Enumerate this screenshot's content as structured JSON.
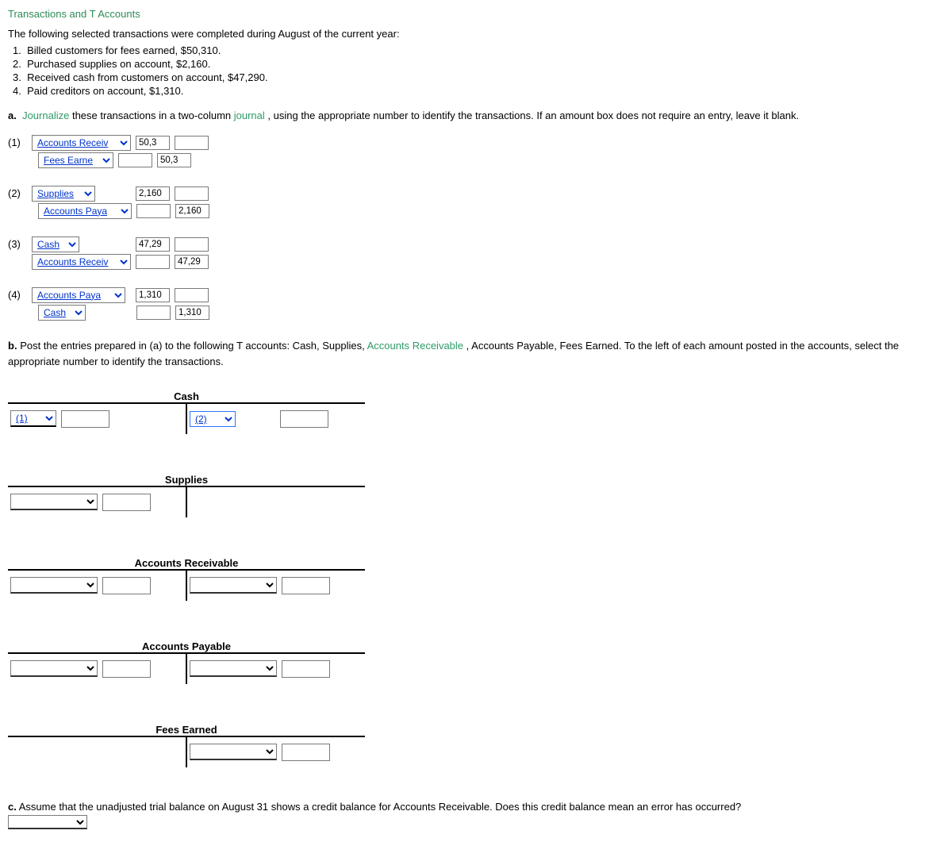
{
  "page_title": "Transactions and T Accounts",
  "intro": "The following selected transactions were completed during August of the current year:",
  "transactions": [
    "Billed customers for fees earned, $50,310.",
    "Purchased supplies on account, $2,160.",
    "Received cash from customers on account, $47,290.",
    "Paid creditors on account, $1,310."
  ],
  "part_a": {
    "label": "a.",
    "kw1": "Journalize",
    "text1": " these transactions in a two-column ",
    "kw2": "journal",
    "text2": ", using the appropriate number to identify the transactions. If an amount box does not require an entry, leave it blank."
  },
  "journal": [
    {
      "n": "(1)",
      "debit_acct": "Accounts Receiv",
      "debit_amt": "50,3",
      "credit_acct": "Fees Earne",
      "credit_amt": "50,3"
    },
    {
      "n": "(2)",
      "debit_acct": "Supplies",
      "debit_amt": "2,160",
      "credit_acct": "Accounts Paya",
      "credit_amt": "2,160"
    },
    {
      "n": "(3)",
      "debit_acct": "Cash",
      "debit_amt": "47,29",
      "credit_acct": "Accounts Receiv",
      "credit_amt": "47,29"
    },
    {
      "n": "(4)",
      "debit_acct": "Accounts Paya",
      "debit_amt": "1,310",
      "credit_acct": "Cash",
      "credit_amt": "1,310"
    }
  ],
  "part_b": {
    "label": "b.",
    "text1": "  Post the entries prepared in (a) to the following T accounts: Cash, Supplies, ",
    "kw": "Accounts Receivable",
    "text2": ", Accounts Payable, Fees Earned. To the left of each amount posted in the accounts, select the appropriate number to identify the transactions."
  },
  "taccts": {
    "cash": {
      "title": "Cash",
      "left_sel": "(1)",
      "right_sel": "(2)"
    },
    "supplies": {
      "title": "Supplies"
    },
    "ar": {
      "title": "Accounts Receivable"
    },
    "ap": {
      "title": "Accounts Payable"
    },
    "fe": {
      "title": "Fees Earned"
    }
  },
  "part_c": {
    "label": "c.",
    "text": "  Assume that the unadjusted trial balance on August 31 shows a credit balance for Accounts Receivable. Does this credit balance mean an error has occurred?"
  }
}
